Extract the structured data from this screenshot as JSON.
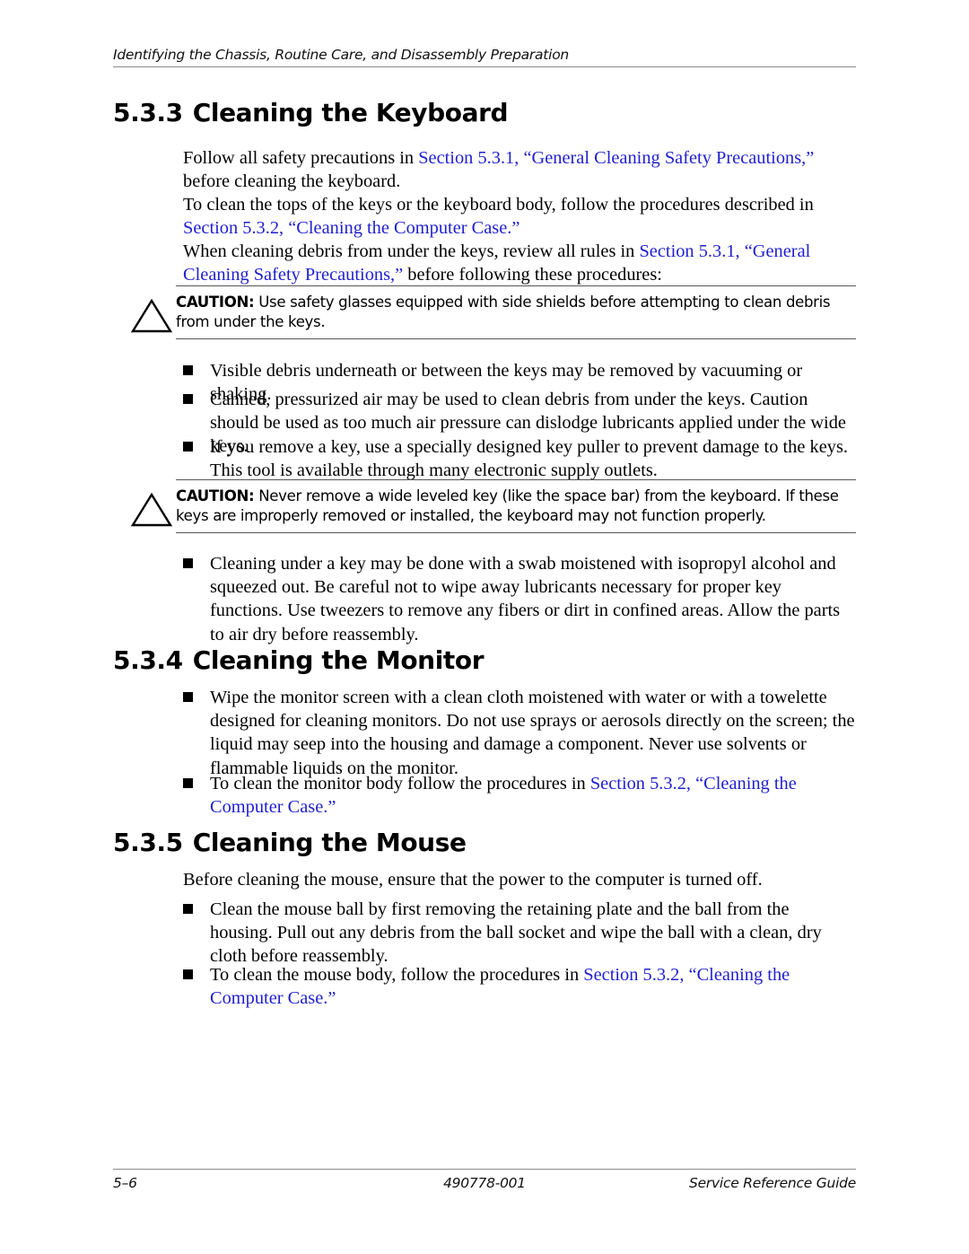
{
  "document": {
    "running_header": "Identifying the Chassis, Routine Care, and Disassembly Preparation",
    "link_color": "#1f1fcf",
    "rule_color": "#8a8a8a"
  },
  "sections": {
    "keyboard": {
      "number": "5.3.3",
      "title": "Cleaning the Keyboard",
      "p1_a": "Follow all safety precautions in ",
      "p1_link": "Section 5.3.1, “General Cleaning Safety Precautions,”",
      "p1_b": " before cleaning the keyboard.",
      "p2_a": "To clean the tops of the keys or the keyboard body, follow the procedures described in ",
      "p2_link": "Section 5.3.2, “Cleaning the Computer Case.”",
      "p3_a": "When cleaning debris from under the keys, review all rules in ",
      "p3_link": "Section 5.3.1, “General Cleaning Safety Precautions,”",
      "p3_b": " before following these procedures:",
      "bullets": [
        "Visible debris underneath or between the keys may be removed by vacuuming or shaking.",
        "Canned, pressurized air may be used to clean debris from under the keys. Caution should be used as too much air pressure can dislodge lubricants applied under the wide keys.",
        "If you remove a key, use a specially designed key puller to prevent damage to the keys. This tool is available through many electronic supply outlets.",
        "Cleaning under a key may be done with a swab moistened with isopropyl alcohol and squeezed out. Be careful not to wipe away lubricants necessary for proper key functions. Use tweezers to remove any fibers or dirt in confined areas. Allow the parts to air dry before reassembly."
      ]
    },
    "monitor": {
      "number": "5.3.4",
      "title": "Cleaning the Monitor",
      "bullet1": "Wipe the monitor screen with a clean cloth moistened with water or with a towelette designed for cleaning monitors. Do not use sprays or aerosols directly on the screen; the liquid may seep into the housing and damage a component. Never use solvents or flammable liquids on the monitor.",
      "bullet2_a": "To clean the monitor body follow the procedures in ",
      "bullet2_link": "Section 5.3.2, “Cleaning the Computer Case.”"
    },
    "mouse": {
      "number": "5.3.5",
      "title": "Cleaning the Mouse",
      "intro": "Before cleaning the mouse, ensure that the power to the computer is turned off.",
      "bullet1": "Clean the mouse ball by first removing the retaining plate and the ball from the housing. Pull out any debris from the ball socket and wipe the ball with a clean, dry cloth before reassembly.",
      "bullet2_a": "To clean the mouse body, follow the procedures in ",
      "bullet2_link": "Section 5.3.2, “Cleaning the Computer Case.”"
    }
  },
  "cautions": [
    {
      "label": "CAUTION:",
      "text": " Use safety glasses equipped with side shields before attempting to clean debris from under the keys."
    },
    {
      "label": "CAUTION:",
      "text": " Never remove a wide leveled key (like the space bar) from the keyboard. If these keys are improperly removed or installed, the keyboard may not function properly."
    }
  ],
  "footer": {
    "page_number": "5–6",
    "part_number": "490778-001",
    "guide_title": "Service Reference Guide"
  }
}
